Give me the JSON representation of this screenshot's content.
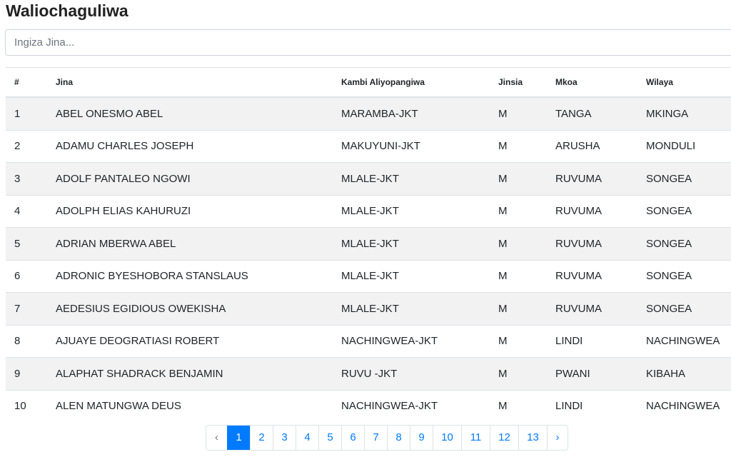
{
  "page": {
    "title": "Waliochaguliwa"
  },
  "search": {
    "placeholder": "Ingiza Jina..."
  },
  "table": {
    "headers": [
      "#",
      "Jina",
      "Kambi Aliyopangiwa",
      "Jinsia",
      "Mkoa",
      "Wilaya"
    ],
    "rows": [
      [
        "1",
        "ABEL ONESMO ABEL",
        "MARAMBA-JKT",
        "M",
        "TANGA",
        "MKINGA"
      ],
      [
        "2",
        "ADAMU CHARLES JOSEPH",
        "MAKUYUNI-JKT",
        "M",
        "ARUSHA",
        "MONDULI"
      ],
      [
        "3",
        "ADOLF PANTALEO NGOWI",
        "MLALE-JKT",
        "M",
        "RUVUMA",
        "SONGEA"
      ],
      [
        "4",
        "ADOLPH ELIAS KAHURUZI",
        "MLALE-JKT",
        "M",
        "RUVUMA",
        "SONGEA"
      ],
      [
        "5",
        "ADRIAN MBERWA ABEL",
        "MLALE-JKT",
        "M",
        "RUVUMA",
        "SONGEA"
      ],
      [
        "6",
        "ADRONIC BYESHOBORA STANSLAUS",
        "MLALE-JKT",
        "M",
        "RUVUMA",
        "SONGEA"
      ],
      [
        "7",
        "AEDESIUS EGIDIOUS OWEKISHA",
        "MLALE-JKT",
        "M",
        "RUVUMA",
        "SONGEA"
      ],
      [
        "8",
        "AJUAYE DEOGRATIASI ROBERT",
        "NACHINGWEA-JKT",
        "M",
        "LINDI",
        "NACHINGWEA"
      ],
      [
        "9",
        "ALAPHAT SHADRACK BENJAMIN",
        "RUVU -JKT",
        "M",
        "PWANI",
        "KIBAHA"
      ],
      [
        "10",
        "ALEN MATUNGWA DEUS",
        "NACHINGWEA-JKT",
        "M",
        "LINDI",
        "NACHINGWEA"
      ]
    ]
  },
  "pagination": {
    "prev_label": "‹",
    "next_label": "›",
    "pages": [
      "1",
      "2",
      "3",
      "4",
      "5",
      "6",
      "7",
      "8",
      "9",
      "10",
      "11",
      "12",
      "13"
    ],
    "active": "1",
    "prev_disabled": true
  },
  "colors": {
    "accent": "#007bff",
    "stripe": "#f2f2f2",
    "border": "#dee2e6"
  }
}
